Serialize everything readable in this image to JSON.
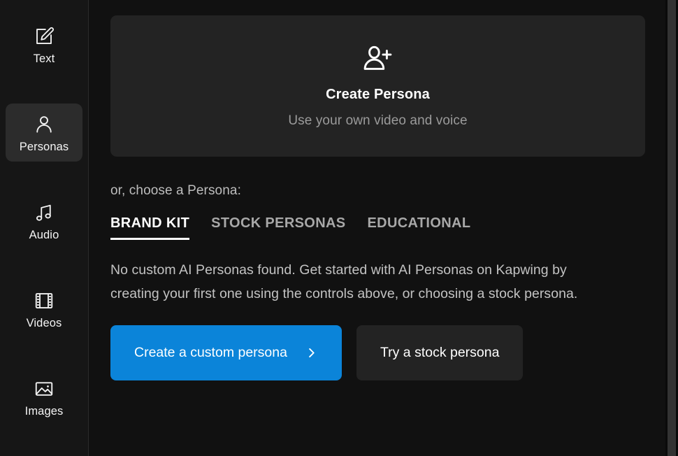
{
  "sidebar": {
    "items": [
      {
        "label": "Text",
        "icon": "text-edit-icon",
        "active": false
      },
      {
        "label": "Personas",
        "icon": "person-icon",
        "active": true
      },
      {
        "label": "Audio",
        "icon": "music-note-icon",
        "active": false
      },
      {
        "label": "Videos",
        "icon": "film-strip-icon",
        "active": false
      },
      {
        "label": "Images",
        "icon": "image-icon",
        "active": false
      }
    ]
  },
  "main": {
    "create_card": {
      "icon": "person-plus-icon",
      "title": "Create Persona",
      "subtitle": "Use your own video and voice"
    },
    "choose_label": "or, choose a Persona:",
    "tabs": [
      {
        "label": "BRAND KIT",
        "active": true
      },
      {
        "label": "STOCK PERSONAS",
        "active": false
      },
      {
        "label": "EDUCATIONAL",
        "active": false
      }
    ],
    "empty_state_text": "No custom AI Personas found. Get started with AI Personas on Kapwing by creating your first one using the controls above, or choosing a stock persona.",
    "primary_button": {
      "label": "Create a custom persona",
      "icon": "chevron-right-icon"
    },
    "secondary_button": {
      "label": "Try a stock persona"
    }
  },
  "colors": {
    "accent_blue": "#0b84d9",
    "page_background": "#111111",
    "sidebar_background": "#161616",
    "card_background": "#232323",
    "active_nav_background": "#2c2c2c",
    "muted_text": "#9b9b9b",
    "body_text": "#c3c3c3"
  },
  "scrollbar": {
    "orientation": "vertical",
    "position": "right"
  }
}
